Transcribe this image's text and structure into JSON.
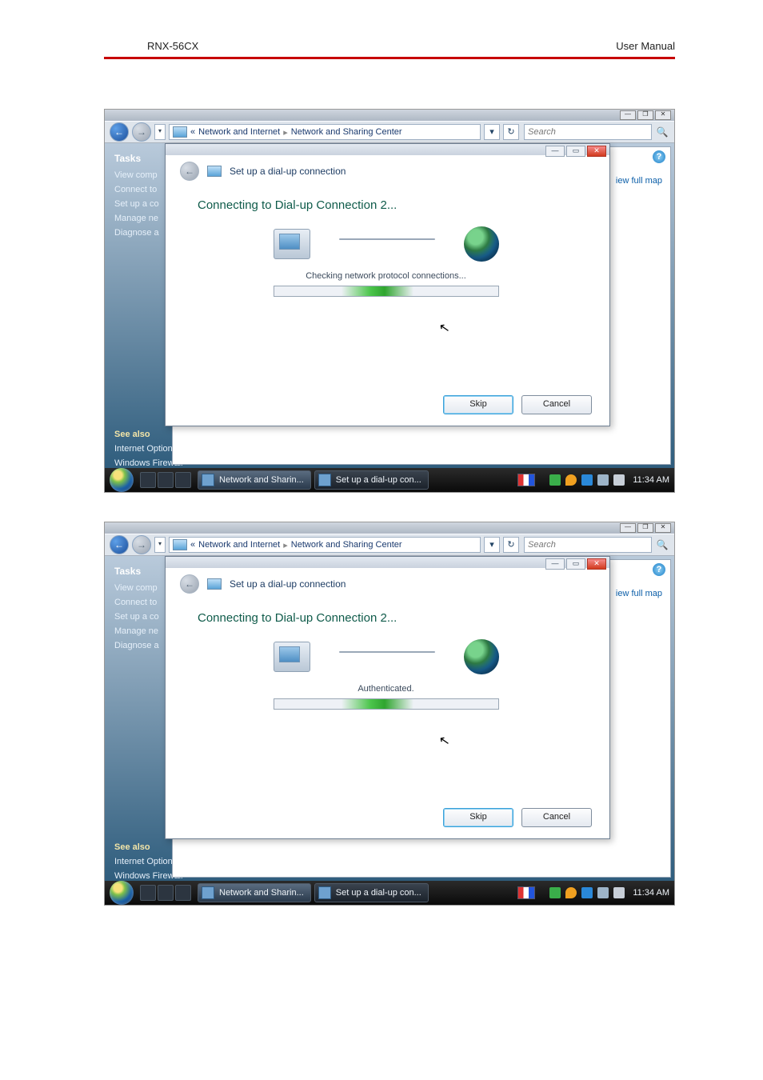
{
  "doc": {
    "model": "RNX-56CX",
    "manual_label": "User  Manual"
  },
  "explorer": {
    "breadcrumb": {
      "prefix": "«",
      "seg1": "Network and Internet",
      "seg2": "Network and Sharing Center"
    },
    "search_placeholder": "Search",
    "view_full_map": "iew full map"
  },
  "sidebar": {
    "tasks_heading": "Tasks",
    "items": [
      "View comp",
      "Connect to",
      "Set up a co",
      "Manage ne",
      "Diagnose a"
    ],
    "see_also": "See also",
    "bottom_links": [
      "Internet Options",
      "Windows Firewall"
    ]
  },
  "dialog": {
    "title": "Set up a dial-up connection",
    "heading": "Connecting to Dial-up Connection 2...",
    "status_checking": "Checking network protocol connections...",
    "status_auth": "Authenticated.",
    "skip": "Skip",
    "cancel": "Cancel"
  },
  "taskbar": {
    "items": [
      "Network and Sharin...",
      "Set up a dial-up con..."
    ],
    "clock": "11:34 AM"
  }
}
